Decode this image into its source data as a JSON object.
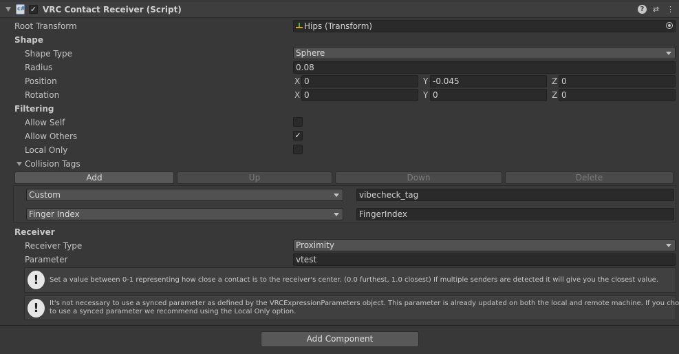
{
  "component": {
    "title": "VRC Contact Receiver (Script)",
    "enabled_mark": "✓",
    "help_icon": "?",
    "settings_icon": "⇄",
    "menu_icon": "⋮"
  },
  "root_transform": {
    "label": "Root Transform",
    "value": "Hips (Transform)"
  },
  "shape": {
    "section": "Shape",
    "shape_type_label": "Shape Type",
    "shape_type_value": "Sphere",
    "radius_label": "Radius",
    "radius_value": "0.08",
    "position_label": "Position",
    "position": {
      "x_label": "X",
      "x": "0",
      "y_label": "Y",
      "y": "-0.045",
      "z_label": "Z",
      "z": "0"
    },
    "rotation_label": "Rotation",
    "rotation": {
      "x_label": "X",
      "x": "0",
      "y_label": "Y",
      "y": "0",
      "z_label": "Z",
      "z": "0"
    }
  },
  "filtering": {
    "section": "Filtering",
    "allow_self_label": "Allow Self",
    "allow_self": false,
    "allow_others_label": "Allow Others",
    "allow_others": true,
    "allow_others_mark": "✓",
    "local_only_label": "Local Only",
    "local_only": false
  },
  "collision_tags": {
    "label": "Collision Tags",
    "buttons": {
      "add": "Add",
      "up": "Up",
      "down": "Down",
      "delete": "Delete"
    },
    "items": [
      {
        "type": "Custom",
        "value": "vibecheck_tag"
      },
      {
        "type": "Finger Index",
        "value": "FingerIndex"
      }
    ]
  },
  "receiver": {
    "section": "Receiver",
    "receiver_type_label": "Receiver Type",
    "receiver_type_value": "Proximity",
    "parameter_label": "Parameter",
    "parameter_value": "vtest"
  },
  "help": {
    "proximity": "Set a value between 0-1 representing how close a contact is to the receiver's center. (0.0 furthest, 1.0 closest)  If multiple senders are detected it will give you the closest value.",
    "synced_line1": "It's not necessary to use a synced parameter as defined by the VRCExpressionParameters object.  This parameter is already updated on both the local and remote machine.  If you choose",
    "synced_line2": "to use a synced parameter we recommend using the Local Only option.",
    "warn_icon": "!"
  },
  "footer": {
    "add_component": "Add Component"
  }
}
